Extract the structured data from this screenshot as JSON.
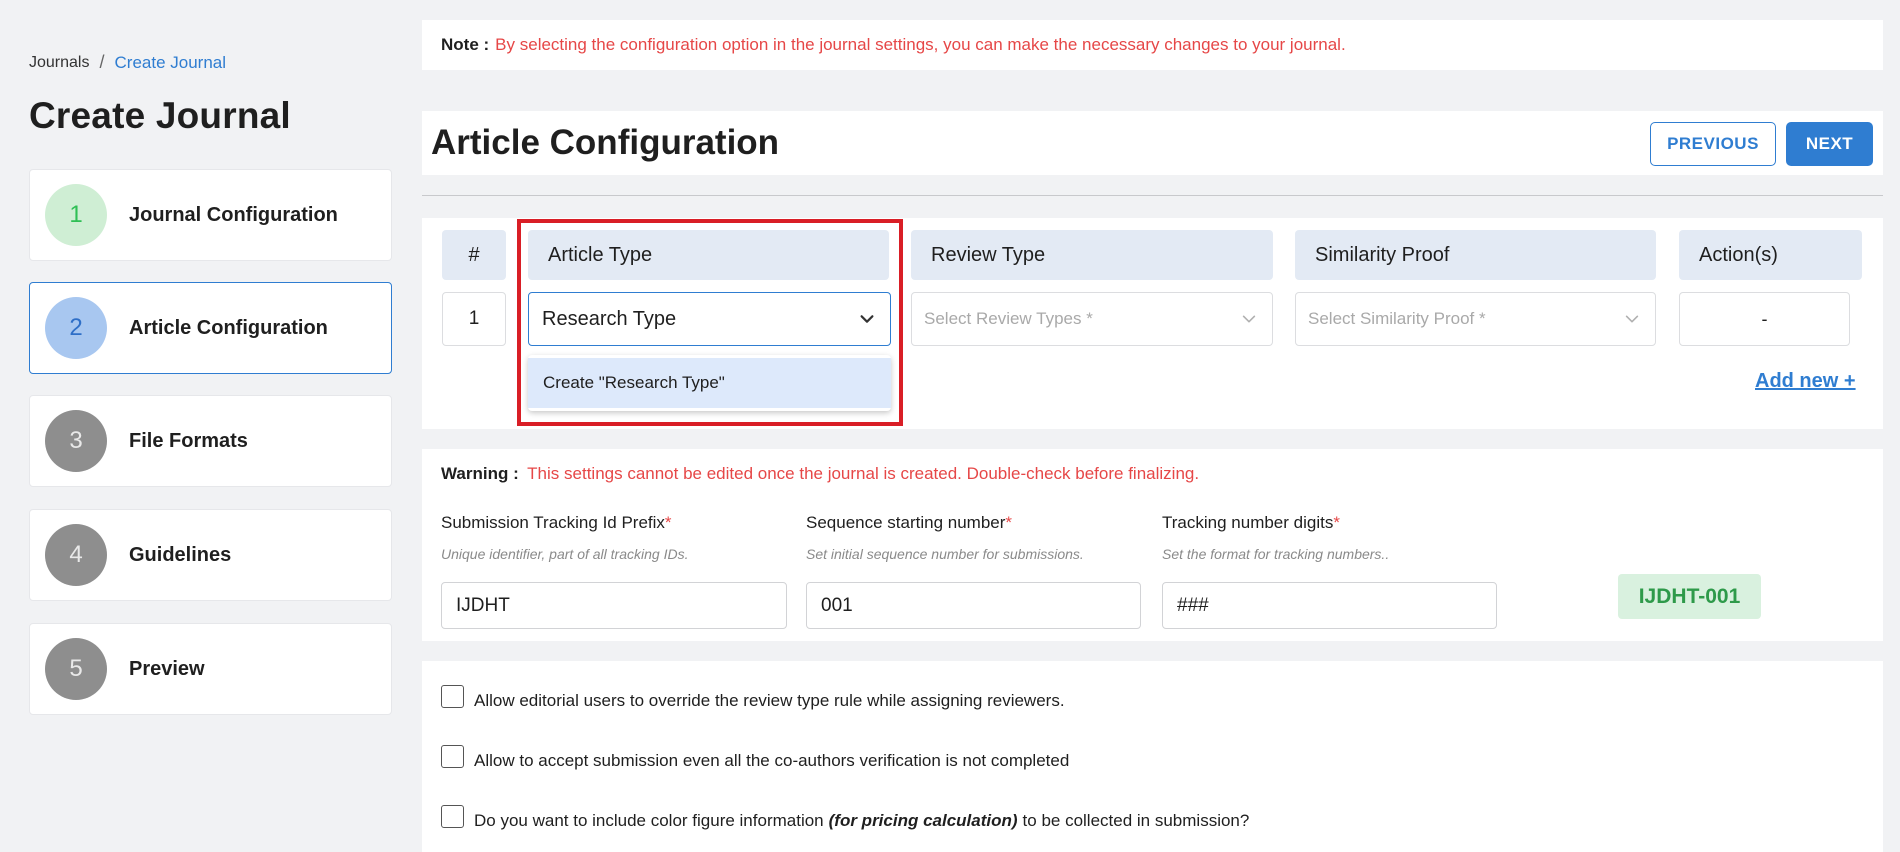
{
  "breadcrumb": {
    "root": "Journals",
    "separator": "/",
    "current": "Create Journal"
  },
  "page_title": "Create Journal",
  "steps": [
    {
      "num": "1",
      "label": "Journal Configuration",
      "state": "done"
    },
    {
      "num": "2",
      "label": "Article Configuration",
      "state": "current"
    },
    {
      "num": "3",
      "label": "File Formats",
      "state": "pending"
    },
    {
      "num": "4",
      "label": "Guidelines",
      "state": "pending"
    },
    {
      "num": "5",
      "label": "Preview",
      "state": "pending"
    }
  ],
  "note": {
    "label": "Note :",
    "text": "By selecting the configuration option in the journal settings, you can make the necessary changes to your journal."
  },
  "section": {
    "title": "Article Configuration",
    "prev_label": "PREVIOUS",
    "next_label": "NEXT"
  },
  "table": {
    "headers": {
      "hash": "#",
      "article_type": "Article Type",
      "review_type": "Review Type",
      "similarity_proof": "Similarity Proof",
      "actions": "Action(s)"
    },
    "row": {
      "num": "1",
      "article_type_value": "Research Type",
      "review_placeholder": "Select Review Types *",
      "similarity_placeholder": "Select Similarity Proof *",
      "action": "-"
    },
    "dropdown_option": "Create \"Research Type\"",
    "add_new": "Add new +"
  },
  "settings": {
    "warning_label": "Warning :",
    "warning_text": "This settings cannot be edited once the journal is created. Double-check before finalizing.",
    "prefix": {
      "label": "Submission Tracking Id Prefix",
      "required": "*",
      "hint": "Unique identifier, part of all tracking IDs.",
      "value": "IJDHT"
    },
    "sequence": {
      "label": "Sequence starting number",
      "required": "*",
      "hint": "Set initial sequence number for submissions.",
      "value": "001"
    },
    "digits": {
      "label": "Tracking number digits",
      "required": "*",
      "hint": "Set the format for tracking numbers..",
      "value": "###"
    },
    "preview": "IJDHT-001"
  },
  "checkboxes": {
    "c1": "Allow editorial users to override the review type rule while assigning reviewers.",
    "c2": "Allow to accept submission even all the co-authors verification is not completed",
    "c3_pre": "Do you want to include color figure information",
    "c3_em": "(for pricing calculation)",
    "c3_post": "to be collected in submission?"
  },
  "colors": {
    "accent": "#2f7dd1",
    "danger": "#e64747",
    "success": "#2e9a4a",
    "highlight": "#d91e26"
  }
}
